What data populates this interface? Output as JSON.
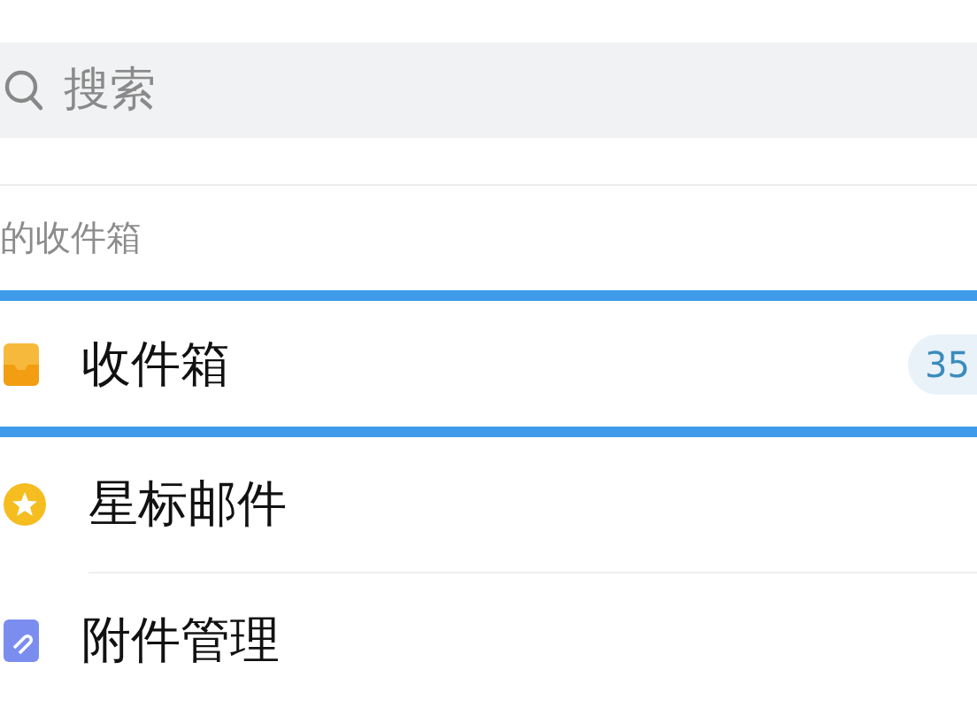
{
  "search": {
    "placeholder": "搜索"
  },
  "section": {
    "title": "的收件箱"
  },
  "folders": [
    {
      "kind": "inbox",
      "label": "收件箱",
      "selected": true,
      "count": "35"
    },
    {
      "kind": "starred",
      "label": "星标邮件",
      "selected": false
    },
    {
      "kind": "attachments",
      "label": "附件管理",
      "selected": false
    }
  ]
}
